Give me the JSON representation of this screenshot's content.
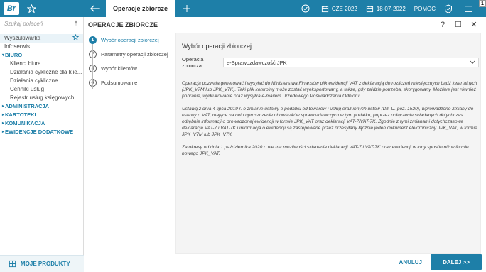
{
  "app": {
    "logo": "Br",
    "active_tab": "Operacje zbiorcze"
  },
  "topbar": {
    "year": "CZE 2022",
    "date": "18-07-2022",
    "help": "POMOC",
    "badge": "1"
  },
  "sidebar": {
    "search_placeholder": "Szukaj poleceń",
    "items": [
      {
        "label": "Wyszukiwarka"
      },
      {
        "label": "Infoserwis"
      }
    ],
    "groups": [
      {
        "label": "BIURO",
        "children": [
          "Klienci biura",
          "Działania cykliczne dla klie...",
          "Działania cykliczne",
          "Cenniki usług",
          "Rejestr usług księgowych"
        ]
      },
      {
        "label": "ADMINISTRACJA"
      },
      {
        "label": "KARTOTEKI"
      },
      {
        "label": "KOMUNIKACJA"
      },
      {
        "label": "EWIDENCJE DODATKOWE"
      }
    ],
    "bottom_label": "MOJE PRODUKTY"
  },
  "main": {
    "title": "OPERACJE ZBIORCZE",
    "steps": [
      {
        "num": "1",
        "label": "Wybór operacji zbiorczej"
      },
      {
        "num": "2",
        "label": "Parametry operacji zbiorczej"
      },
      {
        "num": "3",
        "label": "Wybór klientów"
      },
      {
        "num": "4",
        "label": "Podsumowanie"
      }
    ],
    "panel_title": "Wybór operacji zbiorczej",
    "select_label": "Operacja zbiorcza:",
    "select_value": "e-Sprawozdawczość JPK",
    "paragraphs": [
      "Operacja pozwala generować i wysyłać do Ministerstwa Finansów plik ewidencji VAT z deklaracją do rozliczeń miesięcznych bądź kwartalnych (JPK_V7M lub JPK_V7K). Taki plik kontrolny może zostać wyeksportowany, a także, gdy zajdzie potrzeba, skorygowany. Możliwe jest również pobranie, wydrukowanie oraz wysyłka e-mailem Urzędowego Poświadczenia Odbioru.",
      "Ustawą z dnia 4 lipca 2019 r. o zmianie ustawy o podatku od towarów i usług oraz innych ustaw (Dz. U. poz. 1520), wprowadzono zmiany do ustawy o VAT, mające na celu uproszczenie obowiązków sprawozdawczych w tym podatku, poprzez połączenie składanych dotychczas odrębnie informacji o prowadzonej ewidencji w formie JPK_VAT oraz deklaracji VAT-7/VAT-7K. Zgodnie z tymi zmianami dotychczasowe deklaracje VAT-7 i VAT-7K i informacja o ewidencji są zastępowane przez przesyłany łącznie jeden dokument elektroniczny JPK_VAT, w formie JPK_V7M lub JPK_V7K.",
      "Za okresy od dnia 1 października 2020 r. nie ma możliwości składania deklaracji VAT-7 i VAT-7K oraz ewidencji w inny sposób niż w formie nowego JPK_VAT."
    ],
    "cancel_label": "ANULUJ",
    "next_label": "DALEJ >>"
  },
  "colors": {
    "accent": "#1e7fa8"
  }
}
